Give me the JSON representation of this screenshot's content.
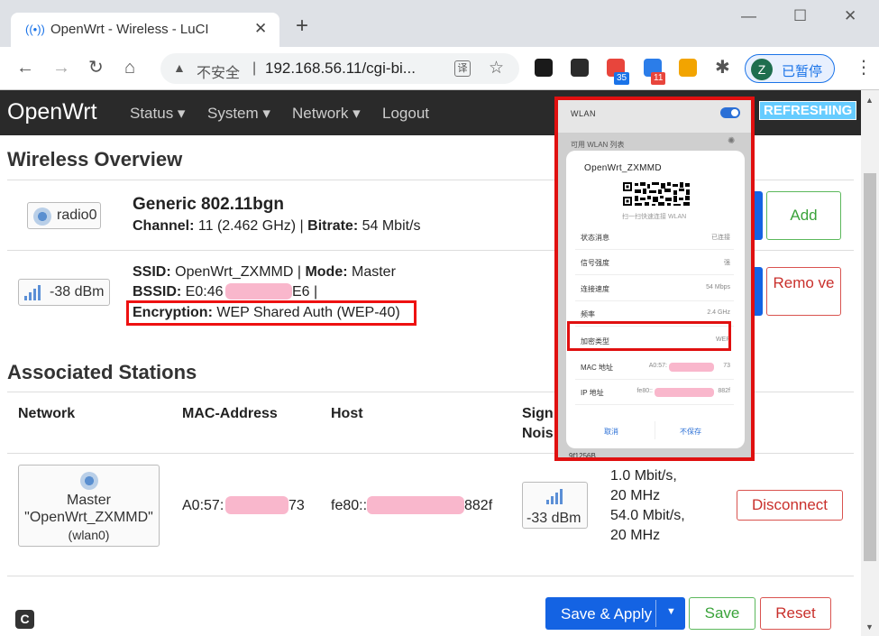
{
  "browser": {
    "tab_title": "OpenWrt - Wireless - LuCI",
    "new_tab": "+",
    "omnibox": {
      "insecure_label": "不安全",
      "url": "192.168.56.11/cgi-bi..."
    },
    "extensions": [
      {
        "name": "ext-1",
        "color": "#1a1a1a",
        "badge": ""
      },
      {
        "name": "ext-2",
        "color": "#2b2b2b",
        "badge": ""
      },
      {
        "name": "ext-3",
        "color": "#e8453c",
        "badge": "35"
      },
      {
        "name": "ext-4",
        "color": "#2b7de9",
        "badge": "11"
      },
      {
        "name": "ext-5",
        "color": "#f2a400",
        "badge": ""
      }
    ],
    "profile": {
      "initial": "Z",
      "label": "已暂停"
    }
  },
  "luci": {
    "brand": "OpenWrt",
    "nav": [
      "Status ▾",
      "System ▾",
      "Network ▾",
      "Logout"
    ],
    "refreshing": "REFRESHING"
  },
  "wireless_overview": {
    "title": "Wireless Overview",
    "radio": {
      "label": "radio0",
      "name": "Generic 802.11bgn",
      "channel_label": "Channel:",
      "channel_value": " 11 (2.462 GHz) | ",
      "bitrate_label": "Bitrate:",
      "bitrate_value": " 54 Mbit/s",
      "add_button": "Add"
    },
    "network": {
      "signal": "-38 dBm",
      "ssid_label": "SSID:",
      "ssid_value": " OpenWrt_ZXMMD | ",
      "mode_label": "Mode:",
      "mode_value": " Master",
      "bssid_label": "BSSID:",
      "bssid_prefix": " E0:46",
      "bssid_suffix": "E6 |",
      "encryption_label": "Encryption:",
      "encryption_value": " WEP Shared Auth (WEP-40)",
      "remove_button": "Remo ve"
    }
  },
  "associated_stations": {
    "title": "Associated Stations",
    "headers": [
      "Network",
      "MAC-Address",
      "Host",
      "Sign",
      "Nois"
    ],
    "row": {
      "network_line1": "Master",
      "network_line2": "\"OpenWrt_ZXMMD\"",
      "network_line3": "(wlan0)",
      "mac_prefix": "A0:57:",
      "mac_suffix": "73",
      "host_prefix": "fe80::",
      "host_suffix": "882f",
      "signal": "-33 dBm",
      "rate_lines": [
        "1.0 Mbit/s,",
        "20 MHz",
        "54.0 Mbit/s,",
        "20 MHz"
      ],
      "disconnect": "Disconnect"
    }
  },
  "footer": {
    "save_apply": "Save & Apply",
    "save": "Save",
    "reset": "Reset"
  },
  "phone": {
    "wlan_title": "WLAN",
    "available_label": "可用 WLAN 列表",
    "ssid": "OpenWrt_ZXMMD",
    "qr_hint": "扫一扫快速连接 WLAN",
    "rows": [
      {
        "key": "状态消息",
        "value": "已连接"
      },
      {
        "key": "信号强度",
        "value": "强"
      },
      {
        "key": "连接速度",
        "value": "54 Mbps"
      },
      {
        "key": "频率",
        "value": "2.4 GHz"
      },
      {
        "key": "加密类型",
        "value": "WEP"
      },
      {
        "key": "MAC 地址",
        "value": "A0:57:"
      },
      {
        "key": "IP 地址",
        "value": "fe80::"
      }
    ],
    "mac_suffix": "73",
    "ip_suffix": "882f",
    "cancel": "取消",
    "forget": "不保存",
    "bottom_fragment": "9f1256B"
  }
}
